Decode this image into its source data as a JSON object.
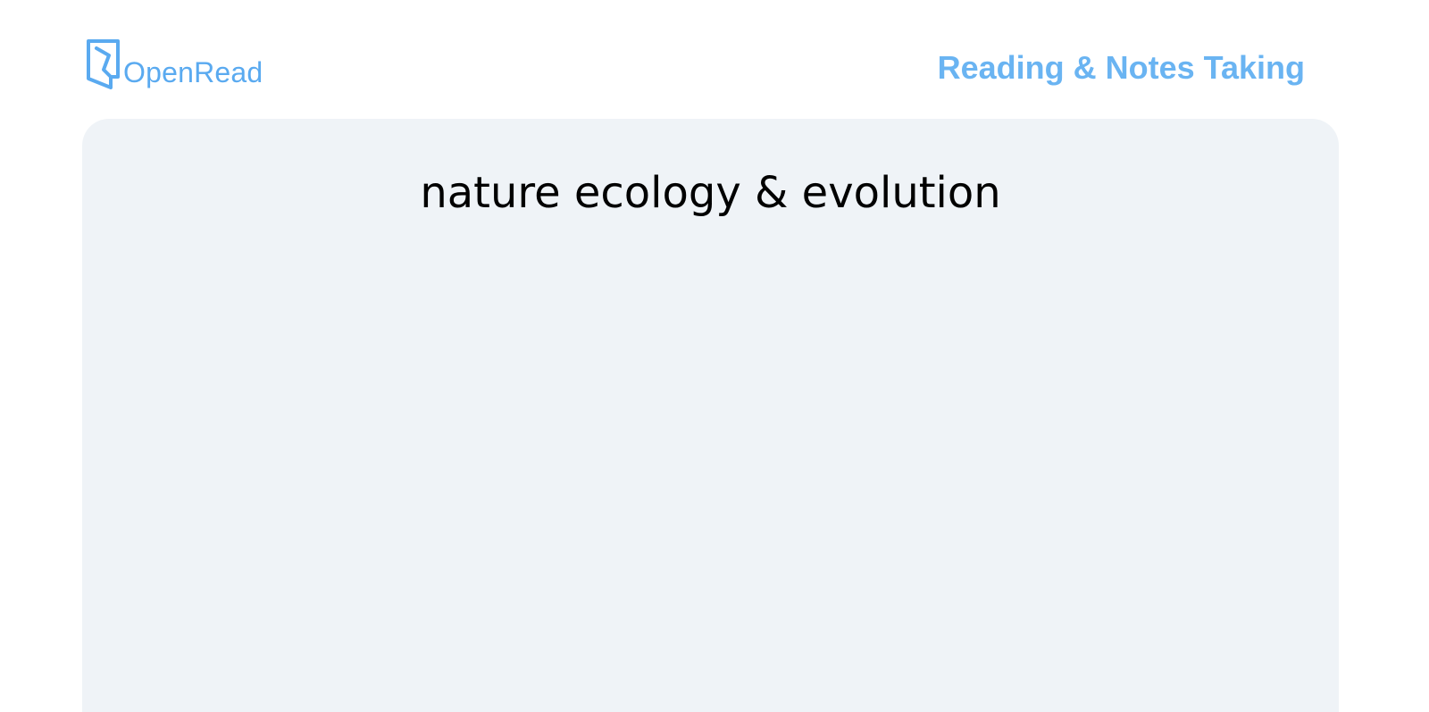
{
  "header": {
    "logo_text": "OpenRead",
    "logo_icon": "openread-logo-icon",
    "tagline": "Reading & Notes Taking"
  },
  "main": {
    "document_title": "nature ecology & evolution"
  },
  "colors": {
    "brand": "#5aaaf0",
    "tagline": "#6ab4f2",
    "card_background": "#eff3f7",
    "title_text": "#000000"
  }
}
